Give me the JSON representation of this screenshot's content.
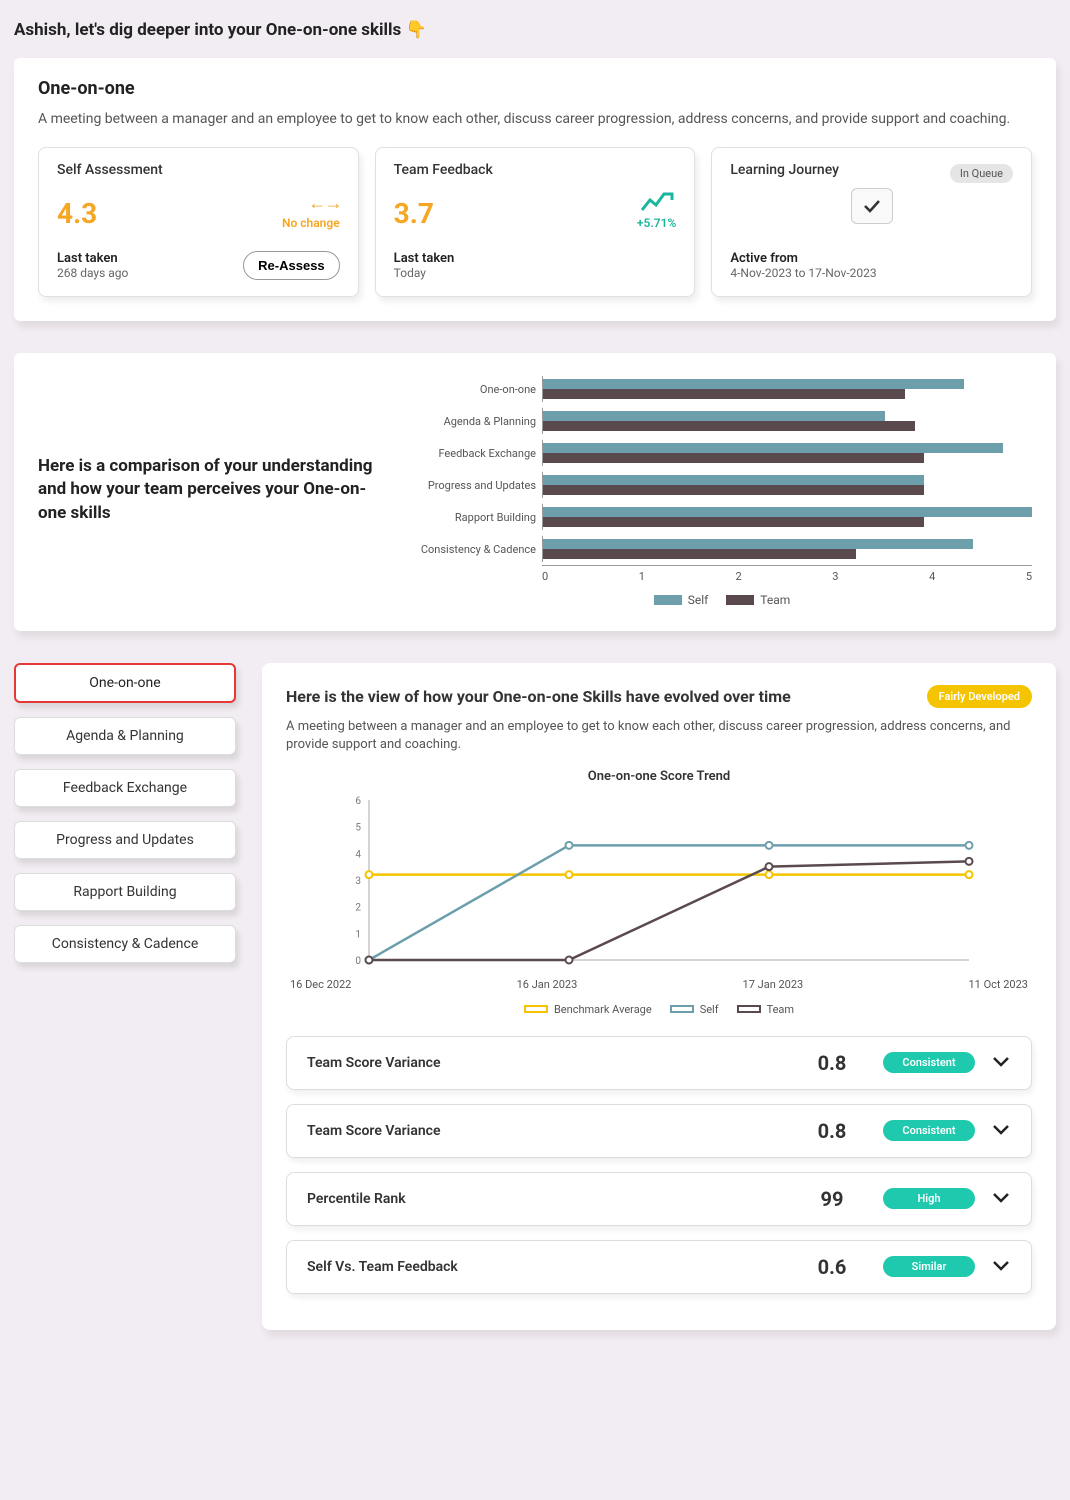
{
  "header": {
    "title": "Ashish, let's dig deeper into your One-on-one skills 👇"
  },
  "overview": {
    "title": "One-on-one",
    "description": "A meeting between a manager and an employee to get to know each other, discuss career progression, address concerns, and provide support and coaching.",
    "metrics": {
      "self": {
        "title": "Self Assessment",
        "score": "4.3",
        "delta_text": "No change",
        "last_label": "Last taken",
        "last_value": "268 days ago",
        "button": "Re-Assess"
      },
      "team": {
        "title": "Team Feedback",
        "score": "3.7",
        "delta_text": "+5.71%",
        "last_label": "Last taken",
        "last_value": "Today"
      },
      "journey": {
        "title": "Learning Journey",
        "badge": "In Queue",
        "active_label": "Active from",
        "active_value": "4-Nov-2023 to 17-Nov-2023"
      }
    }
  },
  "comparison": {
    "heading": "Here is a comparison of your understanding and how your team perceives your One-on-one skills",
    "chart_data": {
      "type": "bar",
      "orientation": "horizontal",
      "categories": [
        "One-on-one",
        "Agenda & Planning",
        "Feedback Exchange",
        "Progress and Updates",
        "Rapport Building",
        "Consistency & Cadence"
      ],
      "series": [
        {
          "name": "Self",
          "color": "#6d9eac",
          "values": [
            4.3,
            3.5,
            4.7,
            3.9,
            5.0,
            4.4
          ]
        },
        {
          "name": "Team",
          "color": "#5b4a4d",
          "values": [
            3.7,
            3.8,
            3.9,
            3.9,
            3.9,
            3.2
          ]
        }
      ],
      "xlim": [
        0,
        5
      ],
      "xticks": [
        0,
        1,
        2,
        3,
        4,
        5
      ]
    },
    "legend": {
      "self": "Self",
      "team": "Team"
    }
  },
  "tabs": [
    {
      "label": "One-on-one",
      "active": true
    },
    {
      "label": "Agenda & Planning",
      "active": false
    },
    {
      "label": "Feedback Exchange",
      "active": false
    },
    {
      "label": "Progress and Updates",
      "active": false
    },
    {
      "label": "Rapport Building",
      "active": false
    },
    {
      "label": "Consistency & Cadence",
      "active": false
    }
  ],
  "trend": {
    "title": "Here is the view of how your One-on-one Skills have evolved over time",
    "badge": "Fairly Developed",
    "description": "A meeting between a manager and an employee to get to know each other, discuss career progression, address concerns, and provide support and coaching.",
    "chart_title": "One-on-one Score Trend",
    "chart_data": {
      "type": "line",
      "x_labels": [
        "16 Dec 2022",
        "16 Jan 2023",
        "17 Jan 2023",
        "11 Oct 2023"
      ],
      "ylim": [
        0,
        6
      ],
      "yticks": [
        0,
        1,
        2,
        3,
        4,
        5,
        6
      ],
      "series": [
        {
          "name": "Benchmark Average",
          "color": "#f5c400",
          "values": [
            3.2,
            3.2,
            3.2,
            3.2
          ]
        },
        {
          "name": "Self",
          "color": "#6d9eac",
          "values": [
            0,
            4.3,
            4.3,
            4.3
          ]
        },
        {
          "name": "Team",
          "color": "#5b4a4d",
          "values": [
            0,
            0,
            3.5,
            3.7
          ]
        }
      ]
    },
    "legend": [
      "Benchmark Average",
      "Self",
      "Team"
    ],
    "stats": [
      {
        "label": "Team Score Variance",
        "value": "0.8",
        "badge": "Consistent"
      },
      {
        "label": "Team Score Variance",
        "value": "0.8",
        "badge": "Consistent"
      },
      {
        "label": "Percentile Rank",
        "value": "99",
        "badge": "High"
      },
      {
        "label": "Self Vs. Team Feedback",
        "value": "0.6",
        "badge": "Similar"
      }
    ]
  }
}
